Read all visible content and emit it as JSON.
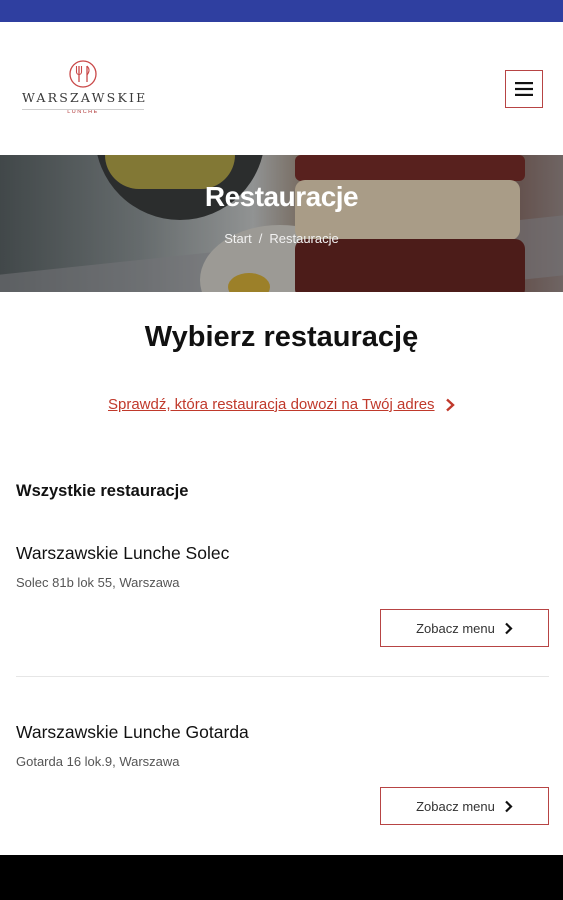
{
  "brand": {
    "name": "WARSZAWSKIE",
    "tagline": "LUNCHE",
    "accent_color": "#b74444",
    "link_color": "#c0392b",
    "status_bar_color": "#2f3fa0"
  },
  "header": {
    "logo_icon": "fork-circle-icon",
    "menu_icon": "hamburger-icon"
  },
  "hero": {
    "title": "Restauracje",
    "breadcrumb": [
      {
        "label": "Start"
      },
      {
        "label": "Restauracje"
      }
    ],
    "breadcrumb_separator": "/"
  },
  "main": {
    "title": "Wybierz restaurację",
    "check_link": "Sprawdź, która restauracja dowozi na Twój adres",
    "section_heading": "Wszystkie restauracje",
    "restaurants": [
      {
        "name": "Warszawskie  Lunche Solec",
        "address": "Solec 81b lok 55, Warszawa",
        "button_label": "Zobacz menu"
      },
      {
        "name": "Warszawskie  Lunche Gotarda",
        "address": "Gotarda 16 lok.9, Warszawa",
        "button_label": "Zobacz menu"
      }
    ]
  }
}
